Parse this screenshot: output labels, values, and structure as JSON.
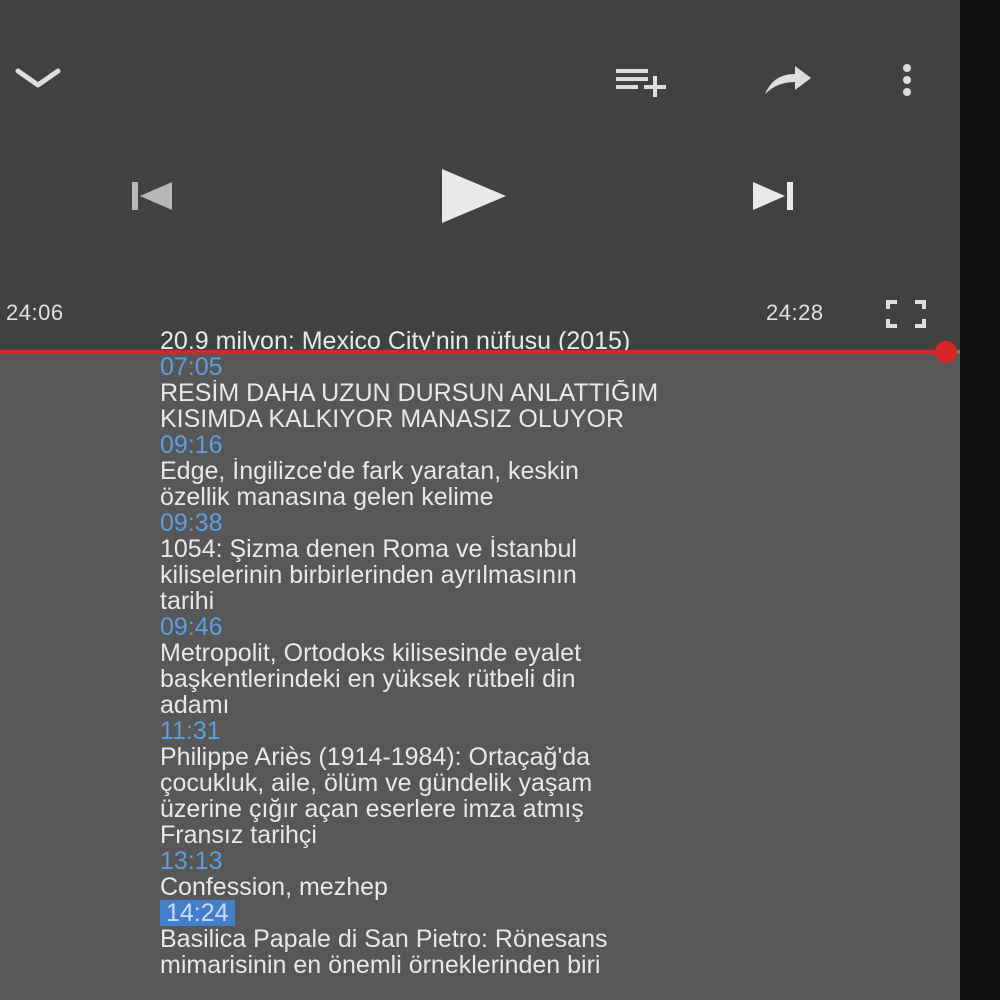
{
  "player": {
    "time_current": "24:06",
    "time_total": "24:28",
    "progress_fraction": 0.985,
    "accent_color": "#e02020",
    "icons": {
      "collapse": "chevron-down-icon",
      "add_to_queue": "add-to-queue-icon",
      "share": "share-icon",
      "more": "more-vertical-icon",
      "previous": "skip-previous-icon",
      "play": "play-icon",
      "next": "skip-next-icon",
      "fullscreen": "fullscreen-icon"
    }
  },
  "description": {
    "lines": [
      {
        "type": "text",
        "text": "20.9 milyon: Mexico City'nin nüfusu (2015)"
      },
      {
        "type": "ts",
        "text": "07:05"
      },
      {
        "type": "text",
        "text": "RESİM DAHA UZUN DURSUN ANLATTIĞIM"
      },
      {
        "type": "text",
        "text": "KISIMDA KALKIYOR MANASIZ OLUYOR"
      },
      {
        "type": "ts",
        "text": "09:16"
      },
      {
        "type": "text",
        "text": "Edge, İngilizce'de fark yaratan, keskin"
      },
      {
        "type": "text",
        "text": "özellik manasına gelen kelime"
      },
      {
        "type": "ts",
        "text": "09:38"
      },
      {
        "type": "text",
        "text": "1054: Şizma denen Roma ve İstanbul"
      },
      {
        "type": "text",
        "text": "kiliselerinin birbirlerinden ayrılmasının"
      },
      {
        "type": "text",
        "text": "tarihi"
      },
      {
        "type": "ts",
        "text": "09:46"
      },
      {
        "type": "text",
        "text": "Metropolit, Ortodoks kilisesinde eyalet"
      },
      {
        "type": "text",
        "text": "başkentlerindeki en yüksek rütbeli din"
      },
      {
        "type": "text",
        "text": "adamı"
      },
      {
        "type": "ts",
        "text": "11:31"
      },
      {
        "type": "text",
        "text": "Philippe Ariès (1914-1984): Ortaçağ'da"
      },
      {
        "type": "text",
        "text": "çocukluk, aile, ölüm ve gündelik yaşam"
      },
      {
        "type": "text",
        "text": "üzerine çığır açan eserlere imza atmış"
      },
      {
        "type": "text",
        "text": "Fransız tarihçi"
      },
      {
        "type": "ts",
        "text": "13:13"
      },
      {
        "type": "text",
        "text": "Confession, mezhep"
      },
      {
        "type": "ts-highlight",
        "text": "14:24"
      },
      {
        "type": "text",
        "text": "Basilica Papale di San Pietro: Rönesans"
      },
      {
        "type": "text",
        "text": "mimarisinin en önemli örneklerinden biri"
      }
    ]
  }
}
